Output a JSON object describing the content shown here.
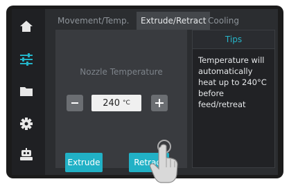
{
  "tabs": [
    {
      "label": "Movement/Temp."
    },
    {
      "label": "Extrude/Retract"
    },
    {
      "label": "Cooling"
    }
  ],
  "active_tab": "Extrude/Retract",
  "sidebar": {
    "items": [
      {
        "icon": "home-icon"
      },
      {
        "icon": "sliders-icon"
      },
      {
        "icon": "folder-icon"
      },
      {
        "icon": "gear-icon"
      },
      {
        "icon": "robot-icon"
      }
    ],
    "active": "sliders-icon"
  },
  "nozzle": {
    "title": "Nozzle Temperature",
    "value": "240",
    "unit": "°C",
    "minus_label": "−",
    "plus_label": "+"
  },
  "actions": {
    "extrude_label": "Extrude",
    "retract_label": "Retract"
  },
  "tips": {
    "header": "Tips",
    "text": "Temperature will automatically heat up to 240°C before feed/retreat"
  },
  "colors": {
    "accent": "#21b1c6",
    "bezel": "#1b1b1b",
    "screen": "#2b2d30",
    "panel": "#393b3f"
  }
}
